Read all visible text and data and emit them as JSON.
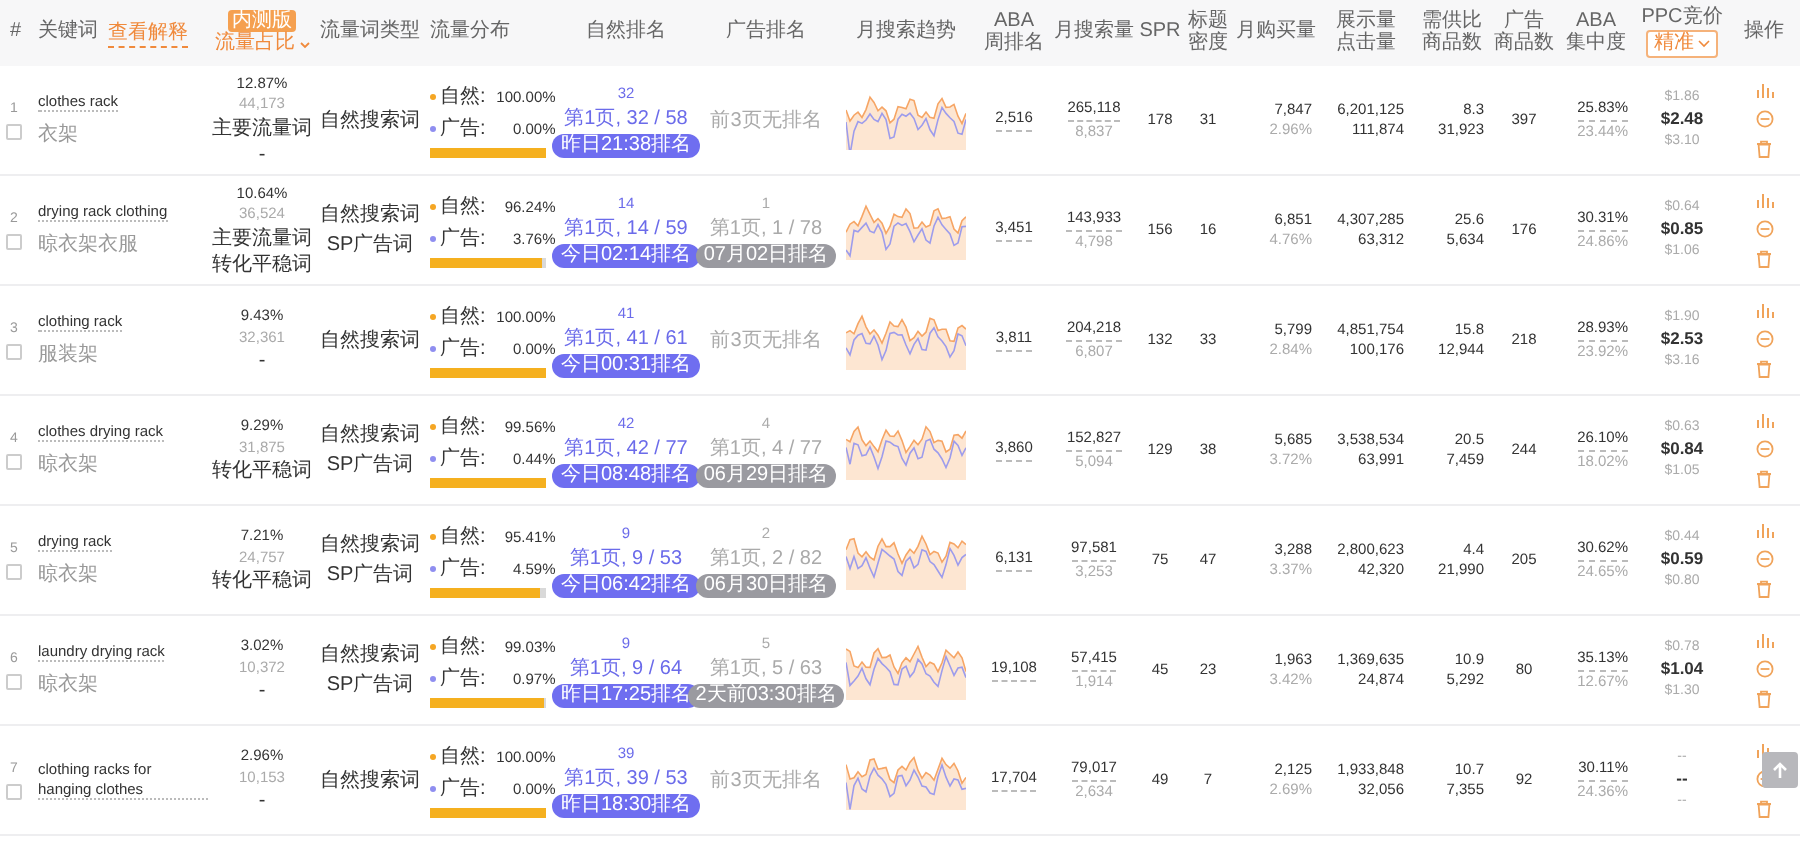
{
  "columns": [
    {
      "label": "#"
    },
    {
      "label": "关键词",
      "link": "查看解释"
    },
    {
      "label": "流量占比",
      "badge": "内测版",
      "sorted": true
    },
    {
      "label": "流量词类型"
    },
    {
      "label": "流量分布"
    },
    {
      "label": "自然排名"
    },
    {
      "label": "广告排名"
    },
    {
      "label": "月搜索趋势"
    },
    {
      "label": [
        "ABA",
        "周排名"
      ]
    },
    {
      "label": "月搜索量"
    },
    {
      "label": "SPR"
    },
    {
      "label": [
        "标题",
        "密度"
      ]
    },
    {
      "label": "月购买量"
    },
    {
      "label": [
        "展示量",
        "点击量"
      ]
    },
    {
      "label": [
        "需供比",
        "商品数"
      ]
    },
    {
      "label": [
        "广告",
        "商品数"
      ]
    },
    {
      "label": [
        "ABA",
        "集中度"
      ]
    },
    {
      "label": "PPC竞价",
      "dropdown": "精准"
    },
    {
      "label": "操作"
    }
  ],
  "rows": [
    {
      "number": "1",
      "checked": false,
      "keyword": "clothes rack",
      "translation": "衣架",
      "share": {
        "percent": "12.87%",
        "volume": "44,173",
        "tags": [
          "主要流量词",
          "-"
        ]
      },
      "types": [
        "自然搜索词"
      ],
      "distribution": {
        "natural_label": "自然:",
        "natural": "100.00%",
        "ad_label": "广告:",
        "ad": "0.00%",
        "level": 1.0
      },
      "organic_rank": {
        "rank": "32",
        "page": "第1页, 32 / 58",
        "time": "昨日21:38排名"
      },
      "ad_rank": {
        "kind": "none",
        "text": "前3页无排名"
      },
      "aba_rank": "2,516",
      "search_volume": [
        "265,118",
        "8,837"
      ],
      "spr": "178",
      "title_density": "31",
      "purchases": [
        "7,847",
        "2.96%"
      ],
      "impressions": [
        "6,201,125",
        "111,874"
      ],
      "demand_supply": [
        "8.3",
        "31,923"
      ],
      "ad_products": "397",
      "concentration": [
        "25.83%",
        "23.44%"
      ],
      "ppc": [
        "$1.86",
        "$2.48",
        "$3.10"
      ]
    },
    {
      "number": "2",
      "checked": false,
      "keyword": "drying rack clothing",
      "translation": "晾衣架衣服",
      "share": {
        "percent": "10.64%",
        "volume": "36,524",
        "tags": [
          "主要流量词",
          "转化平稳词"
        ]
      },
      "types": [
        "自然搜索词",
        "SP广告词"
      ],
      "distribution": {
        "natural_label": "自然:",
        "natural": "96.24%",
        "ad_label": "广告:",
        "ad": "3.76%",
        "level": 0.9624
      },
      "organic_rank": {
        "rank": "14",
        "page": "第1页, 14 / 59",
        "time": "今日02:14排名"
      },
      "ad_rank": {
        "kind": "ranked",
        "rank": "1",
        "page": "第1页, 1 / 78",
        "time": "07月02日排名"
      },
      "aba_rank": "3,451",
      "search_volume": [
        "143,933",
        "4,798"
      ],
      "spr": "156",
      "title_density": "16",
      "purchases": [
        "6,851",
        "4.76%"
      ],
      "impressions": [
        "4,307,285",
        "63,312"
      ],
      "demand_supply": [
        "25.6",
        "5,634"
      ],
      "ad_products": "176",
      "concentration": [
        "30.31%",
        "24.86%"
      ],
      "ppc": [
        "$0.64",
        "$0.85",
        "$1.06"
      ]
    },
    {
      "number": "3",
      "checked": false,
      "keyword": "clothing rack",
      "translation": "服装架",
      "share": {
        "percent": "9.43%",
        "volume": "32,361",
        "tags": [
          "-"
        ]
      },
      "types": [
        "自然搜索词"
      ],
      "distribution": {
        "natural_label": "自然:",
        "natural": "100.00%",
        "ad_label": "广告:",
        "ad": "0.00%",
        "level": 1.0
      },
      "organic_rank": {
        "rank": "41",
        "page": "第1页, 41 / 61",
        "time": "今日00:31排名"
      },
      "ad_rank": {
        "kind": "none",
        "text": "前3页无排名"
      },
      "aba_rank": "3,811",
      "search_volume": [
        "204,218",
        "6,807"
      ],
      "spr": "132",
      "title_density": "33",
      "purchases": [
        "5,799",
        "2.84%"
      ],
      "impressions": [
        "4,851,754",
        "100,176"
      ],
      "demand_supply": [
        "15.8",
        "12,944"
      ],
      "ad_products": "218",
      "concentration": [
        "28.93%",
        "23.92%"
      ],
      "ppc": [
        "$1.90",
        "$2.53",
        "$3.16"
      ]
    },
    {
      "number": "4",
      "checked": false,
      "keyword": "clothes drying rack",
      "translation": "晾衣架",
      "share": {
        "percent": "9.29%",
        "volume": "31,875",
        "tags": [
          "转化平稳词"
        ]
      },
      "types": [
        "自然搜索词",
        "SP广告词"
      ],
      "distribution": {
        "natural_label": "自然:",
        "natural": "99.56%",
        "ad_label": "广告:",
        "ad": "0.44%",
        "level": 0.9956
      },
      "organic_rank": {
        "rank": "42",
        "page": "第1页, 42 / 77",
        "time": "今日08:48排名"
      },
      "ad_rank": {
        "kind": "ranked",
        "rank": "4",
        "page": "第1页, 4 / 77",
        "time": "06月29日排名"
      },
      "aba_rank": "3,860",
      "search_volume": [
        "152,827",
        "5,094"
      ],
      "spr": "129",
      "title_density": "38",
      "purchases": [
        "5,685",
        "3.72%"
      ],
      "impressions": [
        "3,538,534",
        "63,991"
      ],
      "demand_supply": [
        "20.5",
        "7,459"
      ],
      "ad_products": "244",
      "concentration": [
        "26.10%",
        "18.02%"
      ],
      "ppc": [
        "$0.63",
        "$0.84",
        "$1.05"
      ]
    },
    {
      "number": "5",
      "checked": false,
      "keyword": "drying rack",
      "translation": "晾衣架",
      "share": {
        "percent": "7.21%",
        "volume": "24,757",
        "tags": [
          "转化平稳词"
        ]
      },
      "types": [
        "自然搜索词",
        "SP广告词"
      ],
      "distribution": {
        "natural_label": "自然:",
        "natural": "95.41%",
        "ad_label": "广告:",
        "ad": "4.59%",
        "level": 0.9541
      },
      "organic_rank": {
        "rank": "9",
        "page": "第1页, 9 / 53",
        "time": "今日06:42排名"
      },
      "ad_rank": {
        "kind": "ranked",
        "rank": "2",
        "page": "第1页, 2 / 82",
        "time": "06月30日排名"
      },
      "aba_rank": "6,131",
      "search_volume": [
        "97,581",
        "3,253"
      ],
      "spr": "75",
      "title_density": "47",
      "purchases": [
        "3,288",
        "3.37%"
      ],
      "impressions": [
        "2,800,623",
        "42,320"
      ],
      "demand_supply": [
        "4.4",
        "21,990"
      ],
      "ad_products": "205",
      "concentration": [
        "30.62%",
        "24.65%"
      ],
      "ppc": [
        "$0.44",
        "$0.59",
        "$0.80"
      ]
    },
    {
      "number": "6",
      "checked": false,
      "keyword": "laundry drying rack",
      "translation": "晾衣架",
      "share": {
        "percent": "3.02%",
        "volume": "10,372",
        "tags": [
          "-"
        ]
      },
      "types": [
        "自然搜索词",
        "SP广告词"
      ],
      "distribution": {
        "natural_label": "自然:",
        "natural": "99.03%",
        "ad_label": "广告:",
        "ad": "0.97%",
        "level": 0.9903
      },
      "organic_rank": {
        "rank": "9",
        "page": "第1页, 9 / 64",
        "time": "昨日17:25排名"
      },
      "ad_rank": {
        "kind": "ranked",
        "rank": "5",
        "page": "第1页, 5 / 63",
        "time": "2天前03:30排名"
      },
      "aba_rank": "19,108",
      "search_volume": [
        "57,415",
        "1,914"
      ],
      "spr": "45",
      "title_density": "23",
      "purchases": [
        "1,963",
        "3.42%"
      ],
      "impressions": [
        "1,369,635",
        "24,874"
      ],
      "demand_supply": [
        "10.9",
        "5,292"
      ],
      "ad_products": "80",
      "concentration": [
        "35.13%",
        "12.67%"
      ],
      "ppc": [
        "$0.78",
        "$1.04",
        "$1.30"
      ]
    },
    {
      "number": "7",
      "checked": false,
      "keyword": "clothing racks for hanging clothes",
      "share": {
        "percent": "2.96%",
        "volume": "10,153",
        "tags": [
          "-"
        ]
      },
      "types": [
        "自然搜索词"
      ],
      "distribution": {
        "natural_label": "自然:",
        "natural": "100.00%",
        "ad_label": "广告:",
        "ad": "0.00%",
        "level": 1.0
      },
      "organic_rank": {
        "rank": "39",
        "page": "第1页, 39 / 53",
        "time": "昨日18:30排名"
      },
      "ad_rank": {
        "kind": "none",
        "text": "前3页无排名"
      },
      "aba_rank": "17,704",
      "search_volume": [
        "79,017",
        "2,634"
      ],
      "spr": "49",
      "title_density": "7",
      "purchases": [
        "2,125",
        "2.69%"
      ],
      "impressions": [
        "1,933,848",
        "32,056"
      ],
      "demand_supply": [
        "10.7",
        "7,355"
      ],
      "ad_products": "92",
      "concentration": [
        "30.11%",
        "24.36%"
      ],
      "ppc": [
        "--",
        "--",
        "--"
      ]
    }
  ]
}
